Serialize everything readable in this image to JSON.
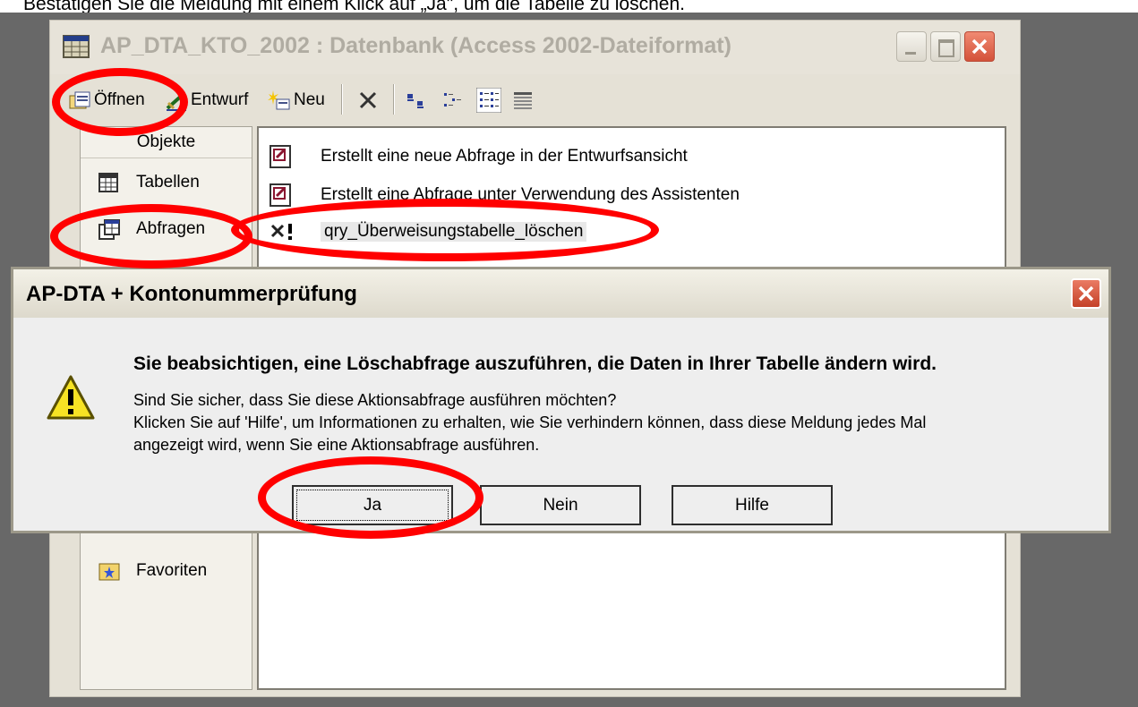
{
  "caption": "Bestätigen Sie die Meldung mit einem Klick auf „Ja\", um die Tabelle zu löschen.",
  "db_window": {
    "title": "AP_DTA_KTO_2002 : Datenbank (Access 2002-Dateiformat)",
    "toolbar": {
      "open_label": "Öffnen",
      "design_label": "Entwurf",
      "new_label": "Neu"
    },
    "objects_header": "Objekte",
    "objects": [
      {
        "label": "Tabellen",
        "icon": "table-icon"
      },
      {
        "label": "Abfragen",
        "icon": "query-icon"
      },
      {
        "label": "Favoriten",
        "icon": "favorites-icon"
      }
    ],
    "list": [
      {
        "label": "Erstellt eine neue Abfrage in der Entwurfsansicht",
        "icon": "wizard-icon"
      },
      {
        "label": "Erstellt eine Abfrage unter Verwendung des Assistenten",
        "icon": "wizard-icon"
      },
      {
        "label": "qry_Überweisungstabelle_löschen",
        "icon": "delete-query-icon"
      }
    ]
  },
  "dialog": {
    "title": "AP-DTA + Kontonummerprüfung",
    "headline": "Sie beabsichtigen, eine Löschabfrage auszuführen, die Daten in Ihrer Tabelle ändern wird.",
    "line1": "Sind Sie sicher, dass Sie diese Aktionsabfrage ausführen möchten?",
    "line2": "Klicken Sie auf 'Hilfe', um Informationen zu erhalten, wie Sie verhindern können, dass diese Meldung jedes Mal",
    "line3": "angezeigt wird, wenn Sie eine Aktionsabfrage ausführen.",
    "buttons": {
      "yes": "Ja",
      "no": "Nein",
      "help": "Hilfe"
    }
  },
  "colors": {
    "annotation": "#ff0000",
    "backdrop": "#686868"
  }
}
